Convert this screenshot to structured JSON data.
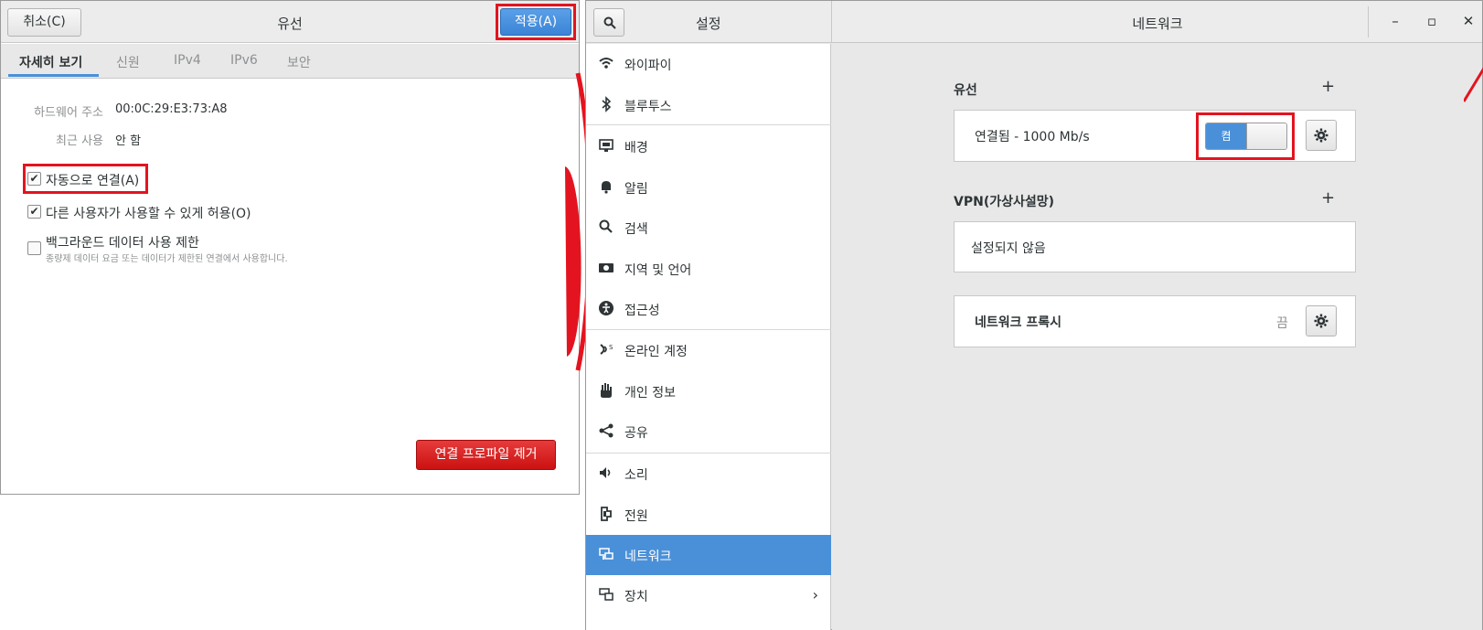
{
  "dialog": {
    "title": "유선",
    "cancel_label": "취소(C)",
    "apply_label": "적용(A)",
    "tabs": [
      "자세히 보기",
      "신원",
      "IPv4",
      "IPv6",
      "보안"
    ],
    "active_tab": "자세히 보기",
    "hw_label": "하드웨어 주소",
    "hw_value": "00:0C:29:E3:73:A8",
    "last_used_label": "최근 사용",
    "last_used_value": "안 함",
    "auto_connect_label": "자동으로 연결(A)",
    "auto_connect_checked": true,
    "allow_others_label": "다른 사용자가 사용할 수 있게 허용(O)",
    "allow_others_checked": true,
    "bg_limit_label": "백그라운드 데이터 사용 제한",
    "bg_limit_desc": "종량제 데이터 요금 또는 데이터가 제한된 연결에서 사용합니다.",
    "bg_limit_checked": false,
    "remove_label": "연결 프로파일 제거"
  },
  "settings": {
    "title": "설정",
    "panel_title": "네트워크",
    "window_controls": [
      "–",
      "▫",
      "✕"
    ],
    "sidebar": [
      {
        "label": "와이파이",
        "icon": "wifi-icon"
      },
      {
        "label": "블루투스",
        "icon": "bluetooth-icon"
      },
      {
        "label": "배경",
        "icon": "background-icon"
      },
      {
        "label": "알림",
        "icon": "bell-icon"
      },
      {
        "label": "검색",
        "icon": "search-icon"
      },
      {
        "label": "지역 및 언어",
        "icon": "region-icon"
      },
      {
        "label": "접근성",
        "icon": "accessibility-icon"
      },
      {
        "label": "온라인 계정",
        "icon": "online-accounts-icon"
      },
      {
        "label": "개인 정보",
        "icon": "privacy-hand-icon"
      },
      {
        "label": "공유",
        "icon": "share-icon"
      },
      {
        "label": "소리",
        "icon": "speaker-icon"
      },
      {
        "label": "전원",
        "icon": "power-icon"
      },
      {
        "label": "네트워크",
        "icon": "network-icon",
        "active": true
      },
      {
        "label": "장치",
        "icon": "devices-icon"
      }
    ],
    "wired_title": "유선",
    "wired_status": "연결됨 - 1000 Mb/s",
    "wired_toggle_label": "켬",
    "vpn_title": "VPN(가상사설망)",
    "vpn_status": "설정되지 않음",
    "proxy_title": "네트워크 프록시",
    "proxy_status": "끔"
  },
  "colors": {
    "accent": "#4a90d9",
    "annotation_red": "#e3141f",
    "danger": "#cc1111"
  }
}
